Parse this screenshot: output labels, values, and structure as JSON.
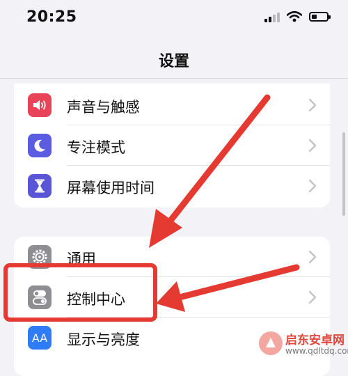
{
  "statusbar": {
    "time": "20:25",
    "icons": [
      "cellular-signal-icon",
      "wifi-icon",
      "battery-icon"
    ],
    "battery_level": 0.35
  },
  "nav": {
    "title": "设置"
  },
  "groups": [
    {
      "items": [
        {
          "label": "声音与触感",
          "icon": "speaker-icon",
          "color": "#e9435a"
        },
        {
          "label": "专注模式",
          "icon": "moon-icon",
          "color": "#5b5ce2"
        },
        {
          "label": "屏幕使用时间",
          "icon": "hourglass-icon",
          "color": "#5a54d6"
        }
      ]
    },
    {
      "items": [
        {
          "label": "通用",
          "icon": "gear-icon",
          "color": "#8e8e93"
        },
        {
          "label": "控制中心",
          "icon": "toggles-icon",
          "color": "#8e8e93"
        },
        {
          "label": "显示与亮度",
          "icon": "aa-text-icon",
          "glyph": "AA",
          "color": "#2f7cf6"
        }
      ]
    }
  ],
  "annotation": {
    "color": "#e53a31"
  },
  "watermark": {
    "title": "启东安卓网",
    "url": "www.qdltdq.com"
  }
}
